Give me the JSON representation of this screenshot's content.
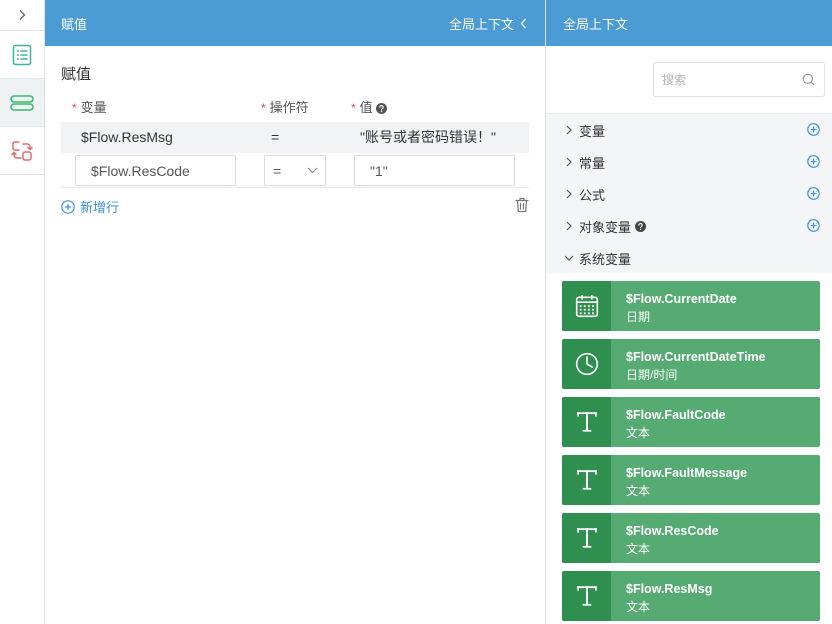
{
  "colors": {
    "header_blue": "#4b9bd5",
    "card_green": "#55ab71",
    "card_icon_green": "#2f8f4e",
    "link_blue": "#3b8fe0",
    "required_red": "#e64b4b",
    "list_icon": "#3fb59c",
    "storage_icon": "#3dba6f",
    "swap_icon": "#e06a6a"
  },
  "sidebar": {
    "toggle_icon": "chevron-right-icon",
    "items": [
      {
        "icon": "list-icon",
        "selected": false
      },
      {
        "icon": "storage-icon",
        "selected": true
      },
      {
        "icon": "swap-icon",
        "selected": false
      }
    ]
  },
  "assign_panel": {
    "header_title": "赋值",
    "header_toggle_label": "全局上下文",
    "header_toggle_icon": "chevron-left-icon",
    "section_title": "赋值",
    "required_mark": "*",
    "columns": {
      "variable": "变量",
      "operator": "操作符",
      "value": "值",
      "value_help_icon": "help-icon"
    },
    "rows": [
      {
        "variable": "$Flow.ResMsg",
        "operator": "=",
        "value": "\"账号或者密码错误！\""
      },
      {
        "variable": "$Flow.ResCode",
        "operator": "=",
        "value": "\"1\"",
        "editing": true
      }
    ],
    "add_row": {
      "icon": "plus-circle-icon",
      "label": "新增行"
    },
    "delete_icon": "trash-icon"
  },
  "context_panel": {
    "header_title": "全局上下文",
    "search": {
      "placeholder": "搜索",
      "icon": "search-icon"
    },
    "tree": [
      {
        "label": "变量",
        "expanded": false,
        "add_icon": "plus-circle-icon"
      },
      {
        "label": "常量",
        "expanded": false,
        "add_icon": "plus-circle-icon"
      },
      {
        "label": "公式",
        "expanded": false,
        "add_icon": "plus-circle-icon"
      },
      {
        "label": "对象变量",
        "expanded": false,
        "help_icon": "help-icon",
        "add_icon": "plus-circle-icon"
      },
      {
        "label": "系统变量",
        "expanded": true
      }
    ],
    "system_variables": [
      {
        "name": "$Flow.CurrentDate",
        "type": "日期",
        "icon": "calendar-icon"
      },
      {
        "name": "$Flow.CurrentDateTime",
        "type": "日期/时间",
        "icon": "clock-icon"
      },
      {
        "name": "$Flow.FaultCode",
        "type": "文本",
        "icon": "text-icon"
      },
      {
        "name": "$Flow.FaultMessage",
        "type": "文本",
        "icon": "text-icon"
      },
      {
        "name": "$Flow.ResCode",
        "type": "文本",
        "icon": "text-icon"
      },
      {
        "name": "$Flow.ResMsg",
        "type": "文本",
        "icon": "text-icon"
      }
    ]
  }
}
